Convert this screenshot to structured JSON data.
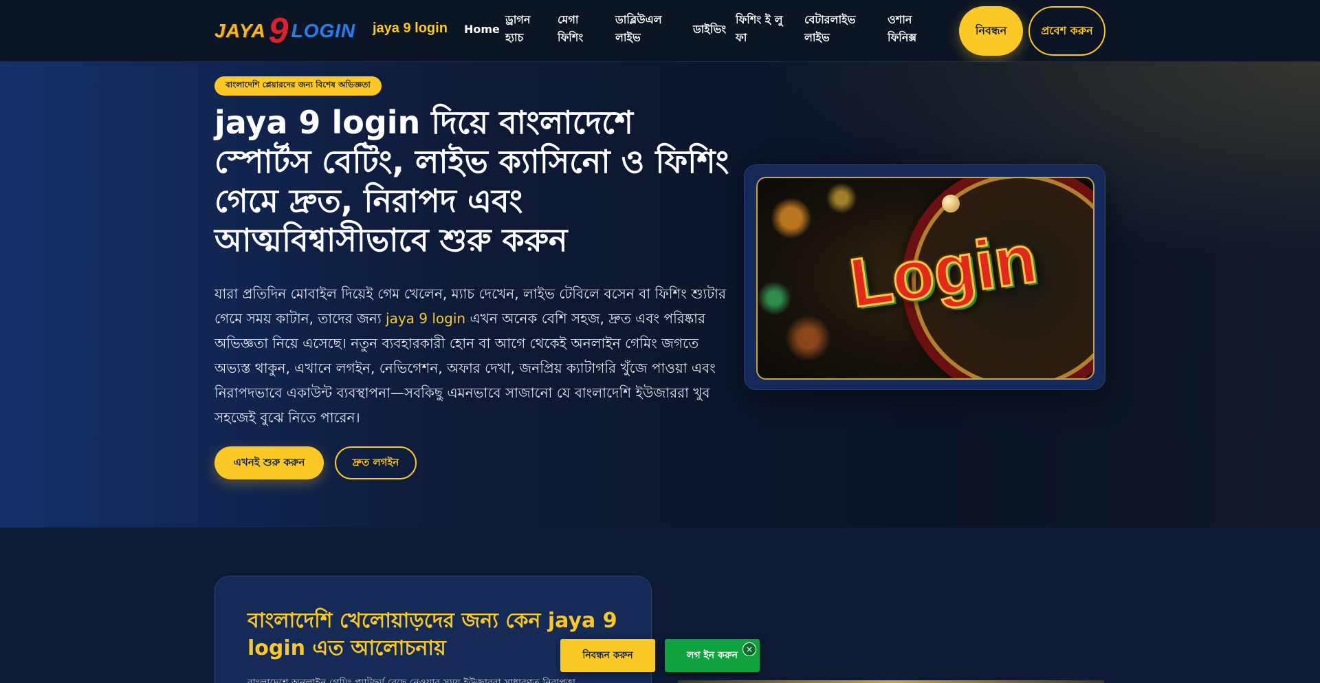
{
  "header": {
    "logo": {
      "part1": "JAYA",
      "part2": "9",
      "part3": "LOGIN"
    },
    "brand_text": "jaya 9 login",
    "nav": [
      {
        "label": "Home"
      },
      {
        "label": "ড্রাগন হ্যাচ"
      },
      {
        "label": "মেগা ফিশিং"
      },
      {
        "label": "ডাব্লিউএল লাইভ"
      },
      {
        "label": "ডাইভিং"
      },
      {
        "label": "ফিশিং ই লু ফা"
      },
      {
        "label": "বেটারলাইভ লাইভ"
      },
      {
        "label": "ওশান ফিনিক্স"
      }
    ],
    "register_label": "নিবন্ধন",
    "login_label": "প্রবেশ করুন"
  },
  "hero": {
    "badge": "বাংলাদেশি প্লেয়ারদের জন্য বিশেষ অভিজ্ঞতা",
    "title": "jaya 9 login দিয়ে বাংলাদেশে স্পোর্টস বেটিং, লাইভ ক্যাসিনো ও ফিশিং গেমে দ্রুত, নিরাপদ এবং আত্মবিশ্বাসীভাবে শুরু করুন",
    "para_before": "যারা প্রতিদিন মোবাইল দিয়েই গেম খেলেন, ম্যাচ দেখেন, লাইভ টেবিলে বসেন বা ফিশিং শ্যুটার গেমে সময় কাটান, তাদের জন্য ",
    "para_highlight": "jaya 9 login",
    "para_after": " এখন অনেক বেশি সহজ, দ্রুত এবং পরিষ্কার অভিজ্ঞতা নিয়ে এসেছে। নতুন ব্যবহারকারী হোন বা আগে থেকেই অনলাইন গেমিং জগতে অভ্যস্ত থাকুন, এখানে লগইন, নেভিগেশন, অফার দেখা, জনপ্রিয় ক্যাটাগরি খুঁজে পাওয়া এবং নিরাপদভাবে একাউন্ট ব্যবস্থাপনা—সবকিছু এমনভাবে সাজানো যে বাংলাদেশি ইউজাররা খুব সহজেই বুঝে নিতে পারেন।",
    "btn_start": "এখনই শুরু করুন",
    "btn_quick": "দ্রুত লগইন",
    "image_text": "Login"
  },
  "why": {
    "title": "বাংলাদেশি খেলোয়াড়দের জন্য কেন jaya 9 login এত আলোচনায়",
    "sub": "বাংলাদেশে অনলাইন গেমিং প্ল্যাটফর্ম বেছে নেওয়ার সময় ইউজাররা সাধারণত নিরাপত্তা"
  },
  "floating": {
    "register": "নিবন্ধন করুন",
    "login": "লগ ইন করুন",
    "close": "×"
  },
  "colors": {
    "accent": "#fcc825",
    "background": "#0d1733",
    "header_bg": "#0c1525",
    "green": "#0fa23e"
  },
  "icons": {
    "close": "close-icon"
  }
}
